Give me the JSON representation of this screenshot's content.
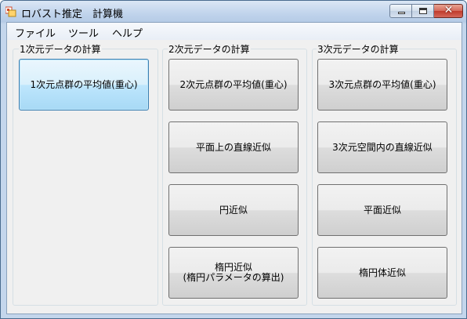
{
  "window": {
    "title": "ロバスト推定　計算機",
    "controls": {
      "minimize": "minimize",
      "maximize": "maximize",
      "close": "✕"
    }
  },
  "menu": {
    "items": [
      "ファイル",
      "ツール",
      "ヘルプ"
    ]
  },
  "groups": [
    {
      "label": "1次元データの計算",
      "buttons": [
        "1次元点群の平均値(重心)"
      ]
    },
    {
      "label": "2次元データの計算",
      "buttons": [
        "2次元点群の平均値(重心)",
        "平面上の直線近似",
        "円近似",
        "楕円近似\n(楕円パラメータの算出)"
      ]
    },
    {
      "label": "3次元データの計算",
      "buttons": [
        "3次元点群の平均値(重心)",
        "3次元空間内の直線近似",
        "平面近似",
        "楕円体近似"
      ]
    }
  ],
  "colors": {
    "title_bar": "#c1d4ec",
    "client_background": "#f0f0f0",
    "focused_button": "#bee6fd",
    "close_button": "#c03a2b"
  }
}
